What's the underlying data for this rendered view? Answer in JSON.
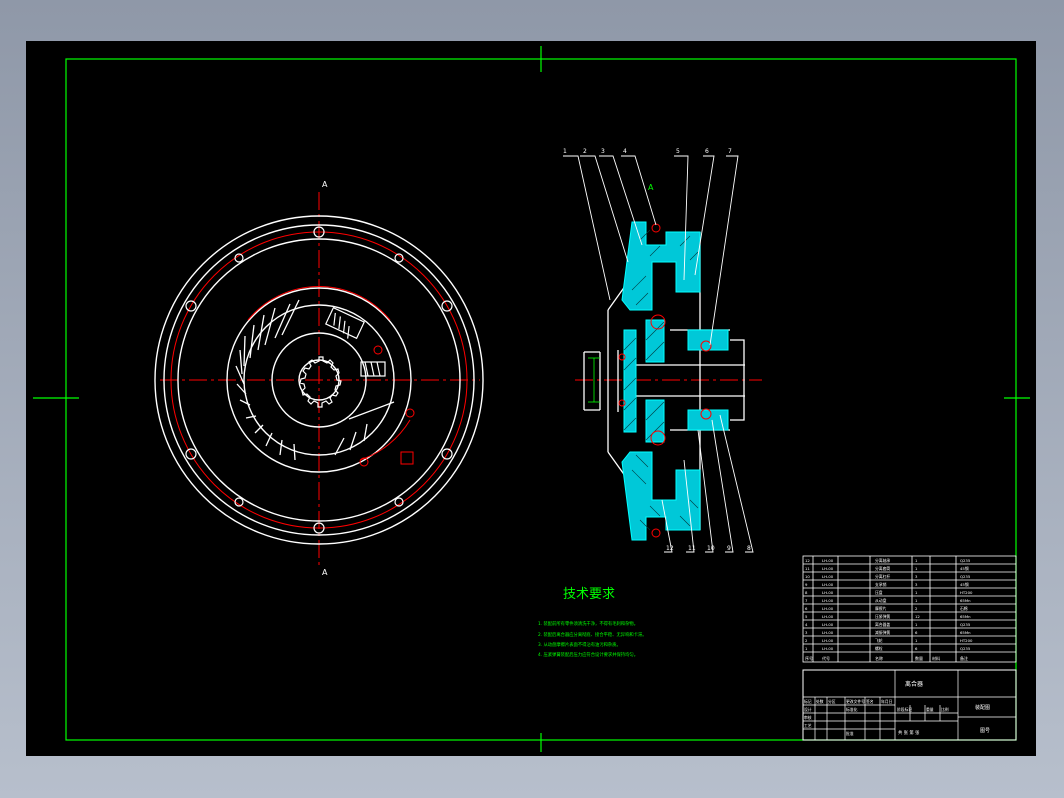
{
  "drawing": {
    "title_heading": "技术要求",
    "tech_notes": [
      "1. 装配前所有零件须清洗干净，不得有毛刺和杂物。",
      "2. 装配后离合器应分离彻底、接合平稳、无异响和卡滞。",
      "3. 从动盘摩擦片表面不得沾有油污和杂质。",
      "4. 压紧弹簧装配后压力应符合设计要求并保持均匀。"
    ],
    "balloon_numbers_top": [
      "1",
      "2",
      "3",
      "4",
      "5",
      "6",
      "7"
    ],
    "balloon_numbers_bottom": [
      "12",
      "11",
      "10",
      "9",
      "8"
    ],
    "section_mark_top": "A",
    "section_mark_bottom": "A",
    "section_marker_right": "A"
  },
  "parts_list": {
    "rows": [
      [
        "12",
        "LH-00",
        "分离轴承",
        "1",
        "",
        "Q235"
      ],
      [
        "11",
        "LH-00",
        "分离套筒",
        "1",
        "",
        "45钢"
      ],
      [
        "10",
        "LH-00",
        "分离杠杆",
        "3",
        "",
        "Q235"
      ],
      [
        "9",
        "LH-00",
        "支承销",
        "3",
        "",
        "45钢"
      ],
      [
        "8",
        "LH-00",
        "压盘",
        "1",
        "",
        "HT200"
      ],
      [
        "7",
        "LH-00",
        "从动盘",
        "1",
        "",
        "65Mn"
      ],
      [
        "6",
        "LH-00",
        "摩擦片",
        "2",
        "",
        "石棉"
      ],
      [
        "5",
        "LH-00",
        "压紧弹簧",
        "12",
        "",
        "65Mn"
      ],
      [
        "4",
        "LH-00",
        "离合器盖",
        "1",
        "",
        "Q235"
      ],
      [
        "3",
        "LH-00",
        "减振弹簧",
        "6",
        "",
        "65Mn"
      ],
      [
        "2",
        "LH-00",
        "飞轮",
        "1",
        "",
        "HT200"
      ],
      [
        "1",
        "LH-00",
        "螺栓",
        "6",
        "",
        "Q235"
      ]
    ],
    "header": [
      "序号",
      "代号",
      "名称",
      "数量",
      "材料",
      "备注"
    ]
  },
  "title_block": {
    "drawing_name": "离合器",
    "labels": [
      "标记",
      "处数",
      "分区",
      "更改文件号",
      "签名",
      "年月日",
      "设计",
      "审核",
      "工艺",
      "标准化",
      "批准"
    ],
    "scale_labels": [
      "阶段标记",
      "重量",
      "比例"
    ],
    "sheet_label": "共  张  第  张",
    "drawing_no": "装配图",
    "part_code": "图号"
  },
  "colors": {
    "background": "#000000",
    "frame": "#00ff00",
    "outline": "#ffffff",
    "centerline": "#ff0000",
    "section": "#00ffff",
    "text": "#00ff00"
  }
}
